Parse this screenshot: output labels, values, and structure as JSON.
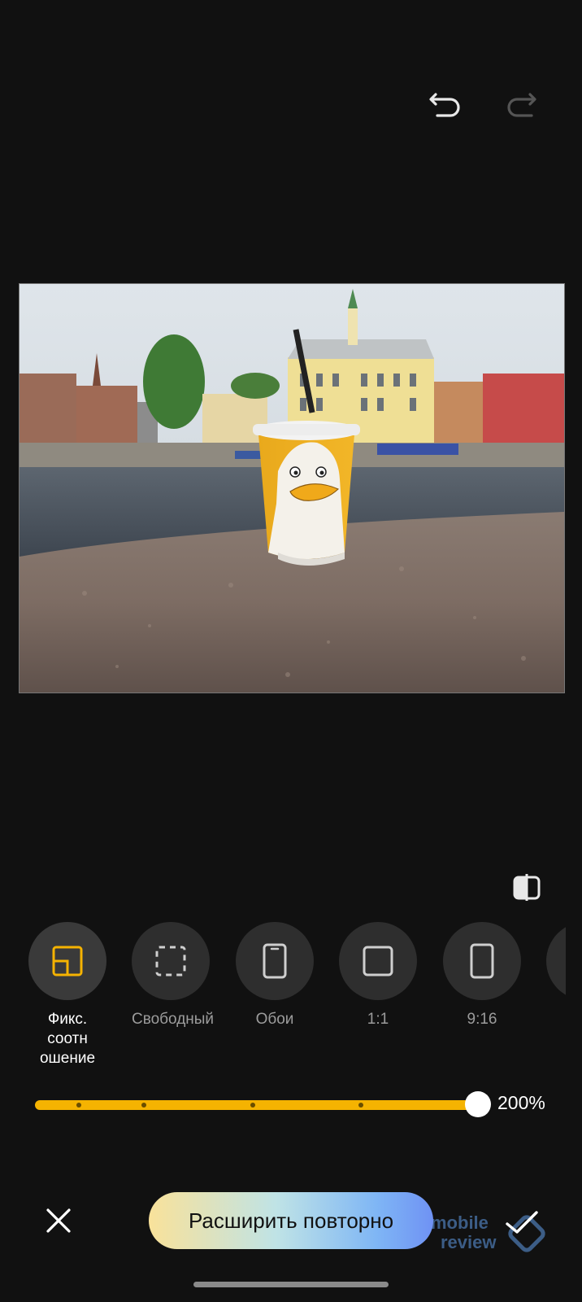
{
  "toolbar": {
    "undo_icon": "undo-arrow-icon",
    "redo_icon": "redo-arrow-icon"
  },
  "photo": {
    "description_icon": "photo"
  },
  "compare_icon": "compare-split-icon",
  "ratio_options": [
    {
      "label": "Фикс. соотн\nошение",
      "icon": "fixed-ratio-icon",
      "active": true
    },
    {
      "label": "Свободный",
      "icon": "free-crop-icon",
      "active": false
    },
    {
      "label": "Обои",
      "icon": "phone-wallpaper-icon",
      "active": false
    },
    {
      "label": "1:1",
      "icon": "square-icon",
      "active": false
    },
    {
      "label": "9:16",
      "icon": "portrait-rect-icon",
      "active": false
    }
  ],
  "zoom": {
    "value_text": "200%",
    "level_fraction": 1.0
  },
  "actions": {
    "cancel_icon": "close-icon",
    "expand_label": "Расширить повторно",
    "confirm_icon": "check-icon"
  },
  "watermark": {
    "line1": "mobile",
    "line2": "review"
  },
  "colors": {
    "accent": "#f5b301",
    "background": "#111111",
    "option_bg": "#2e2e2e"
  }
}
